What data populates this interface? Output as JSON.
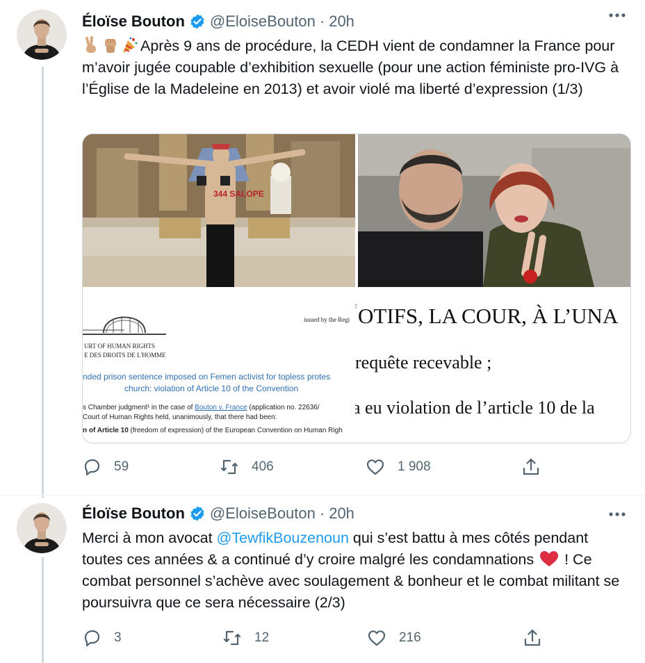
{
  "colors": {
    "accent": "#1d9bf0",
    "text": "#0f1419",
    "muted": "#536471",
    "heart": "#e0245e",
    "border": "#cfd9de"
  },
  "tweets": [
    {
      "author_name": "Éloïse Bouton",
      "handle": "@EloiseBouton",
      "separator": "·",
      "time": "20h",
      "emojis": [
        "victory-hand-emoji",
        "raised-fist-emoji",
        "party-popper-emoji"
      ],
      "text": "Après 9 ans de procédure, la CEDH vient de condamner la France pour m’avoir jugée coupable d’exhibition sexuelle (pour une action féministe pro-IVG à l’Église de la Madeleine en 2013) et avoir violé ma liberté d’expression (1/3)",
      "media": {
        "photo1_sign": "344 SALOPE",
        "doc1": {
          "issued_by": "issued by the Regi",
          "court_line1": "URT OF HUMAN RIGHTS",
          "court_line2": "E DES DROITS DE L'HOMME",
          "headline_line1": "nded prison sentence imposed on Femen activist for topless protes",
          "headline_line2": "church: violation of Article 10 of the Convention",
          "body_line1_a": "s Chamber judgment¹ in the case of ",
          "body_line1_link": "Bouton v. France",
          "body_line1_b": " (application no. 22636/",
          "body_line2": "Court of Human Rights held, unanimously, that there had been:",
          "body_line3_a": "n of Article 10",
          "body_line3_b": " (freedom of expression) of the European Convention on Human Righ"
        },
        "doc2": {
          "letter": "F",
          "line1": "OTIFS, LA COUR, À L’UNA",
          "line2": "requête recevable ;",
          "line3": "a eu violation de l’article 10 de la"
        }
      },
      "replies": "59",
      "retweets": "406",
      "likes": "1 908"
    },
    {
      "author_name": "Éloïse Bouton",
      "handle": "@EloiseBouton",
      "separator": "·",
      "time": "20h",
      "text_a": "Merci à mon avocat ",
      "mention": "@TewfikBouzenoun",
      "text_b": " qui s’est battu à mes côtés pendant toutes ces années & a continué d’y croire malgré les condamnations ",
      "text_c": " ! Ce combat personnel s’achève avec soulagement & bonheur et le combat militant se poursuivra que ce sera nécessaire (2/3)",
      "inline_emoji": "red-heart-emoji",
      "replies": "3",
      "retweets": "12",
      "likes": "216"
    }
  ]
}
